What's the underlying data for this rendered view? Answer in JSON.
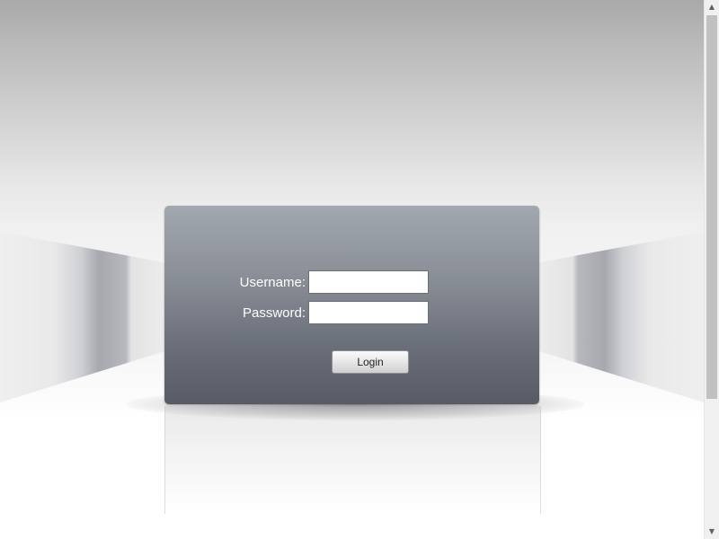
{
  "login": {
    "username_label": "Username:",
    "password_label": "Password:",
    "username_value": "",
    "password_value": "",
    "login_button_label": "Login"
  },
  "scrollbar": {
    "up_arrow_icon": "triangle-up",
    "down_arrow_icon": "triangle-down"
  }
}
